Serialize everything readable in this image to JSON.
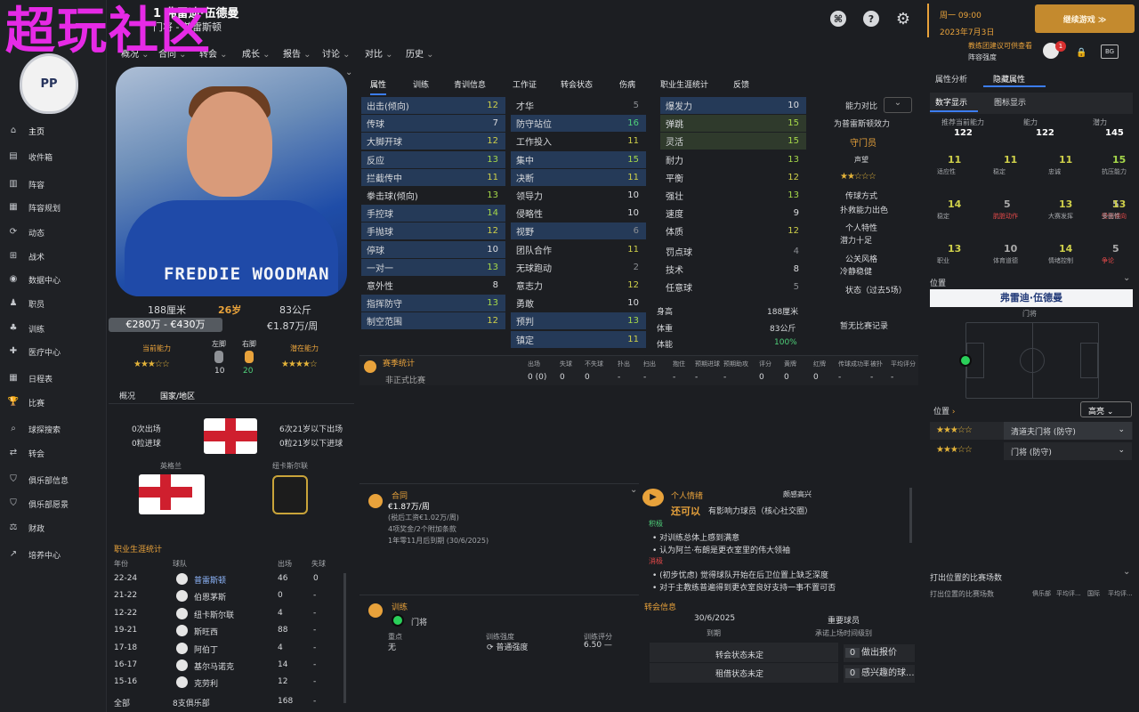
{
  "watermark": "超玩社区",
  "header": {
    "name": "1 弗雷迪·伍德曼",
    "sub": "门将 - 普雷斯顿"
  },
  "header_menu": [
    "概况",
    "合同",
    "转会",
    "成长",
    "报告",
    "讨论",
    "对比",
    "历史"
  ],
  "datebox": {
    "day": "周一 09:00",
    "date": "2023年7月3日"
  },
  "continue": "继续游戏 ≫",
  "notice": {
    "l1": "教练团建议可供查看",
    "l2": "阵容强度",
    "count": "1"
  },
  "club_logo": "PP",
  "sidebar": [
    "主页",
    "收件箱",
    "阵容",
    "阵容规划",
    "动态",
    "战术",
    "数据中心",
    "职员",
    "训练",
    "医疗中心",
    "日程表",
    "比赛",
    "球探搜索",
    "转会",
    "俱乐部信息",
    "俱乐部愿景",
    "财政",
    "培养中心"
  ],
  "shirt_name": "FREDDIE WOODMAN",
  "bio": {
    "height": "188厘米",
    "age": "26岁",
    "weight": "83公斤",
    "value": "€280万 - €430万",
    "wage": "€1.87万/周",
    "ca_label": "当前能力",
    "pa_label": "潜在能力",
    "left_label": "左脚",
    "right_label": "右脚",
    "left": "10",
    "right": "20"
  },
  "attr_tabs": [
    "属性",
    "训练",
    "青训信息",
    "工作证",
    "转会状态",
    "伤病",
    "职业生涯统计",
    "反馈"
  ],
  "col1": [
    [
      "出击(倾向)",
      "12"
    ],
    [
      "传球",
      "7"
    ],
    [
      "大脚开球",
      "12"
    ],
    [
      "反应",
      "13"
    ],
    [
      "拦截传中",
      "11"
    ],
    [
      "拳击球(倾向)",
      "13"
    ],
    [
      "手控球",
      "14"
    ],
    [
      "手抛球",
      "12"
    ],
    [
      "停球",
      "10"
    ],
    [
      "一对一",
      "13"
    ],
    [
      "意外性",
      "8"
    ],
    [
      "指挥防守",
      "13"
    ],
    [
      "制空范围",
      "12"
    ]
  ],
  "col2": [
    [
      "才华",
      "5"
    ],
    [
      "防守站位",
      "16"
    ],
    [
      "工作投入",
      "11"
    ],
    [
      "集中",
      "15"
    ],
    [
      "决断",
      "11"
    ],
    [
      "领导力",
      "10"
    ],
    [
      "侵略性",
      "10"
    ],
    [
      "视野",
      "6"
    ],
    [
      "团队合作",
      "11"
    ],
    [
      "无球跑动",
      "2"
    ],
    [
      "意志力",
      "12"
    ],
    [
      "勇敢",
      "10"
    ],
    [
      "预判",
      "13"
    ],
    [
      "镇定",
      "11"
    ]
  ],
  "col3": [
    [
      "爆发力",
      "10"
    ],
    [
      "弹跳",
      "15"
    ],
    [
      "灵活",
      "15"
    ],
    [
      "耐力",
      "13"
    ],
    [
      "平衡",
      "12"
    ],
    [
      "强壮",
      "13"
    ],
    [
      "速度",
      "9"
    ],
    [
      "体质",
      "12"
    ]
  ],
  "col3b": [
    [
      "罚点球",
      "4"
    ],
    [
      "技术",
      "8"
    ],
    [
      "任意球",
      "5"
    ]
  ],
  "physical": [
    [
      "身高",
      "188厘米"
    ],
    [
      "体重",
      "83公斤"
    ],
    [
      "体能",
      "100%"
    ]
  ],
  "compare": {
    "title": "能力对比",
    "sub": "为普雷斯顿效力",
    "role": "守门员",
    "rep": "声望",
    "items": [
      "传球方式",
      "扑救能力出色",
      "个人特性",
      "潜力十足",
      "公关风格",
      "冷静稳健",
      "状态（过去5场）",
      "暂无比赛记录"
    ]
  },
  "season": {
    "title": "赛季统计",
    "headers": [
      "出场",
      "失球",
      "不失球",
      "扑出",
      "扫出",
      "抱住",
      "预期进球",
      "预期助攻",
      "评分",
      "黄牌",
      "红牌",
      "传球成功率",
      "被扑",
      "平均评分"
    ],
    "row_label": "非正式比赛",
    "row": [
      "0 (0)",
      "0",
      "0",
      "-",
      "-",
      "-",
      "-",
      "-",
      "0",
      "0",
      "0",
      "-",
      "-",
      "-"
    ]
  },
  "nation": {
    "tabs": [
      "概况",
      "国家/地区"
    ],
    "caps": "0次出场",
    "goals": "0粒进球",
    "u21caps": "6次21岁以下出场",
    "u21goals": "0粒21岁以下进球",
    "nation": "英格兰",
    "club": "纽卡斯尔联"
  },
  "career": {
    "title": "职业生涯统计",
    "headers": [
      "年份",
      "球队",
      "出场",
      "失球"
    ],
    "rows": [
      [
        "22-24",
        "普雷斯顿",
        "46",
        "0"
      ],
      [
        "21-22",
        "伯恩茅斯",
        "0",
        "-"
      ],
      [
        "12-22",
        "纽卡斯尔联",
        "4",
        "-"
      ],
      [
        "19-21",
        "斯旺西",
        "88",
        "-"
      ],
      [
        "17-18",
        "阿伯丁",
        "4",
        "-"
      ],
      [
        "16-17",
        "基尔马诺克",
        "14",
        "-"
      ],
      [
        "15-16",
        "克劳利",
        "12",
        "-"
      ]
    ],
    "total": [
      "全部",
      "8支俱乐部",
      "168",
      "-"
    ]
  },
  "contract": {
    "title": "合同",
    "wage": "€1.87万/周",
    "tax": "(税后工资€1.02万/周)",
    "bonus": "4项奖金/2个附加条款",
    "expires": "1年零11月后到期 (30/6/2025)"
  },
  "emotion": {
    "title": "个人情绪",
    "mood": "颇感高兴",
    "line1": "还可以",
    "line2": "有影响力球员（核心社交圈）",
    "pos_label": "积极",
    "pos": [
      "对训练总体上感到满意",
      "认为阿兰·布朗是更衣室里的伟大领袖"
    ],
    "neg_label": "消极",
    "neg": [
      "(初步忧虑) 觉得球队开始在后卫位置上缺乏深度",
      "对于主教练普遍得到更衣室良好支持一事不置可否"
    ]
  },
  "training": {
    "title": "训练",
    "role": "门将",
    "focus_l": "重点",
    "focus": "无",
    "int_l": "训练强度",
    "int": "普通强度",
    "rate_l": "训练评分",
    "rate": "6.50"
  },
  "transfer": {
    "title": "转会信息",
    "date": "30/6/2025",
    "date_l": "到期",
    "status": "重要球员",
    "status_l": "承诺上场时间级别",
    "t1": "转会状态未定",
    "t2": "租借状态未定",
    "o1": "做出报价",
    "o2": "感兴趣的球..."
  },
  "right": {
    "tabs": [
      "属性分析",
      "隐藏属性"
    ],
    "sub": [
      "数字显示",
      "图标显示"
    ],
    "stats": [
      [
        "推荐当前能力",
        "122"
      ],
      [
        "能力",
        "122"
      ],
      [
        "潜力",
        "145"
      ]
    ],
    "hidden": [
      [
        "适应性",
        "11"
      ],
      [
        "稳定",
        "11"
      ],
      [
        "忠诚",
        "11"
      ],
      [
        "抗压能力",
        "15"
      ],
      [
        "稳定",
        "14"
      ],
      [
        "肮脏动作",
        "5"
      ],
      [
        "大赛发挥",
        "13"
      ],
      [
        "受伤倾向",
        "5"
      ],
      [
        "多面性",
        "13"
      ],
      [
        "职业",
        "13"
      ],
      [
        "体育道德",
        "10"
      ],
      [
        "情绪控制",
        "14"
      ],
      [
        "争论",
        "5"
      ]
    ],
    "pos_title": "位置",
    "pos_name": "弗雷迪·伍德曼",
    "pos_role": "门将",
    "pos2": "位置",
    "filter": "高亮",
    "roles": [
      "清道夫门将 (防守)",
      "门将 (防守)"
    ],
    "games": "打出位置的比赛场数",
    "games_sub": "打出位置的比赛场数",
    "games_cols": [
      "俱乐部",
      "平均评...",
      "国际",
      "平均评..."
    ]
  },
  "colors": {
    "accent": "#e8a23b",
    "blue_hl": "#253a58",
    "green": "#a6d84a"
  }
}
